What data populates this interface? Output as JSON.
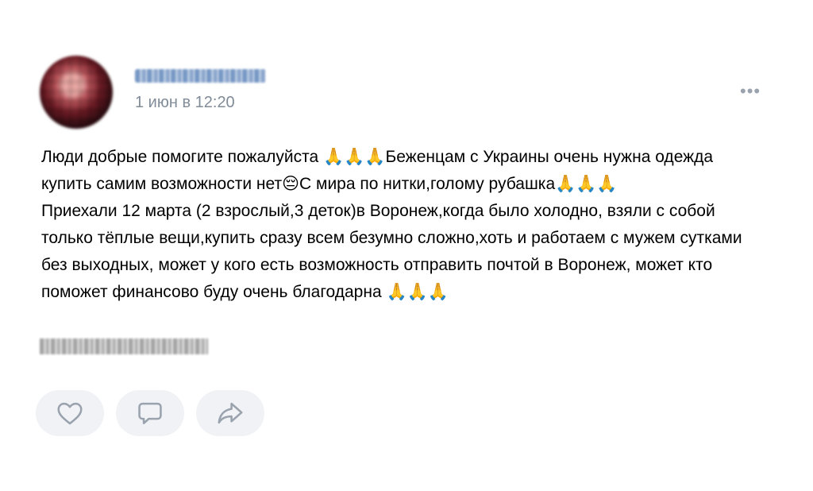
{
  "post": {
    "author_name": "Ирина Зинина",
    "date": "1 июн в 12:20",
    "text": "Люди добрые помогите пожалуйста 🙏🙏🙏Беженцам с Украины очень нужна одежда купить самим возможности нет😔С мира по нитки,голому рубашка🙏🙏🙏\nПриехали 12 марта (2 взрослый,3 деток)в Воронеж,когда было холодно, взяли с собой только тёплые вещи,купить сразу всем безумно сложно,хоть и работаем с мужем сутками без выходных, может у кого есть возможность отправить почтой в Воронеж, может кто поможет финансово буду очень благодарна 🙏🙏🙏",
    "more_label": "•••"
  },
  "actions": {
    "like_icon": "heart-icon",
    "comment_icon": "comment-icon",
    "share_icon": "share-icon"
  },
  "colors": {
    "meta_text": "#818c99",
    "button_bg": "#f0f2f5",
    "icon": "#99a2ad"
  }
}
